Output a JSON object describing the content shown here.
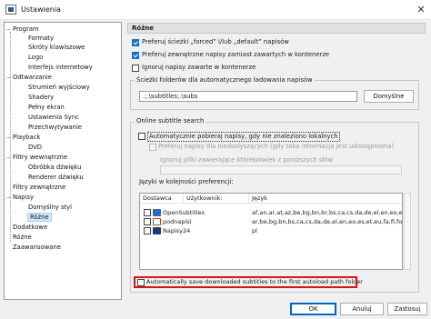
{
  "window": {
    "title": "Ustawienia",
    "close_glyph": "✕"
  },
  "tree": [
    {
      "label": "Program",
      "expander": "−"
    },
    {
      "label": "Formaty"
    },
    {
      "label": "Skróty klawiszowe"
    },
    {
      "label": "Logo"
    },
    {
      "label": "Interfejs internetowy"
    },
    {
      "label": "Odtwarzanie",
      "expander": "−"
    },
    {
      "label": "Strumień wyjściowy"
    },
    {
      "label": "Shadery"
    },
    {
      "label": "Pełny ekran"
    },
    {
      "label": "Ustawienia Sync"
    },
    {
      "label": "Przechwytywanie"
    },
    {
      "label": "Playback",
      "expander": "−"
    },
    {
      "label": "DVD"
    },
    {
      "label": "Filtry wewnętrzne",
      "expander": "−"
    },
    {
      "label": "Obróbka dźwięku"
    },
    {
      "label": "Renderer dźwięku"
    },
    {
      "label": "Filtry zewnętrzne"
    },
    {
      "label": "Napisy",
      "expander": "−"
    },
    {
      "label": "Domyślny styl"
    },
    {
      "label": "Różne",
      "selected": true
    },
    {
      "label": "Dodatkowe"
    },
    {
      "label": "Różne"
    },
    {
      "label": "Zaawansowane"
    }
  ],
  "panel": {
    "heading": "Różne",
    "options": {
      "forced_default": {
        "label": "Preferuj ścieżki „forced” i/lub „default” napisów",
        "checked": true
      },
      "external_first": {
        "label": "Preferuj zewnętrzne napisy zamiast zawartych w kontenerze",
        "checked": true
      },
      "ignore_embedded": {
        "label": "Ignoruj napisy zawarte w kontenerze",
        "checked": false
      }
    },
    "autoload": {
      "title": "Ścieżki folderów dla automatycznego ładowania napisów",
      "value": ".;.\\subtitles;.\\subs",
      "default_button": "Domyślne"
    },
    "online": {
      "title": "Online subtitle search",
      "auto_download": {
        "label": "Automatycznie pobieraj napisy, gdy nie znaleziono lokalnych",
        "checked": false
      },
      "prefer_hearing": {
        "label": "Preferuj napisy dla niedosłyszących (gdy taka informacja jest udostępniona)",
        "checked": false
      },
      "ignore_files_label": "Ignoruj pliki zawierające którekolwiek z poniższych słów",
      "ignore_files_value": "",
      "languages_label": "Języki w kolejności preferencji:",
      "languages_value": "",
      "columns": [
        "Dostawca",
        "Użytkownik:",
        "Język"
      ],
      "providers": [
        {
          "name": "OpenSubtitles",
          "user": "",
          "languages": "af,an,ar,at,az,be,bg,bn,br,bs,ca,cs,da,de,el,en,eo,es,et,eu",
          "icon_color": "#2d6ab8",
          "checked": false
        },
        {
          "name": "podnapisi",
          "user": "",
          "languages": "ar,be,bg,bn,bs,ca,cs,da,de,el,en,eo,es,et,eu,fa,fi,fo,fr",
          "icon_color": "#c0392b",
          "checked": false
        },
        {
          "name": "Napisy24",
          "user": "",
          "languages": "pl",
          "icon_color": "#1c3d7a",
          "checked": false
        }
      ],
      "save_to_first": {
        "label": "Automatically save downloaded subtitles to the first autoload path folder",
        "checked": false
      }
    }
  },
  "footer": {
    "ok": "OK",
    "cancel": "Anuluj",
    "apply": "Zastosuj"
  }
}
